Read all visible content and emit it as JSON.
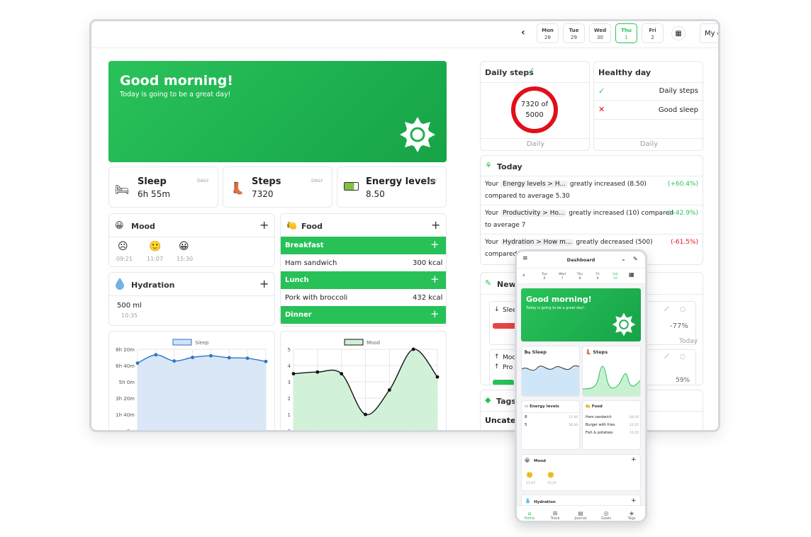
{
  "topbar": {
    "days": [
      {
        "dow": "Mon",
        "num": "28"
      },
      {
        "dow": "Tue",
        "num": "29"
      },
      {
        "dow": "Wed",
        "num": "30"
      },
      {
        "dow": "Thu",
        "num": "1"
      },
      {
        "dow": "Fri",
        "num": "2"
      }
    ],
    "dashboard_select": "My d"
  },
  "hero": {
    "title": "Good morning!",
    "subtitle": "Today is going to be a great day!"
  },
  "stats": {
    "sleep": {
      "label": "Sleep",
      "value": "6h 55m",
      "tag": "DAILY"
    },
    "steps": {
      "label": "Steps",
      "value": "7320",
      "tag": "DAILY"
    },
    "energy": {
      "label": "Energy levels",
      "value": "8.50",
      "tag": "DAILY"
    }
  },
  "mood": {
    "title": "Mood",
    "entries": [
      {
        "emoji": "☹",
        "time": "09:21"
      },
      {
        "emoji": "🙂",
        "time": "11:07"
      },
      {
        "emoji": "😀",
        "time": "15:30"
      }
    ]
  },
  "food": {
    "title": "Food",
    "meals": [
      {
        "name": "Breakfast",
        "items": [
          {
            "name": "Ham sandwich",
            "kcal": "300 kcal"
          }
        ]
      },
      {
        "name": "Lunch",
        "items": [
          {
            "name": "Pork with broccoli",
            "kcal": "432 kcal"
          }
        ]
      },
      {
        "name": "Dinner",
        "items": []
      }
    ]
  },
  "hydration": {
    "title": "Hydration",
    "value": "500 ml",
    "time": "10:35"
  },
  "sleep_chart": {
    "legend": "Sleep",
    "yticks": [
      "8h 20m",
      "6h 40m",
      "5h 0m",
      "3h 20m",
      "1h 40m",
      "0m"
    ]
  },
  "mood_chart": {
    "legend": "Mood",
    "yticks": [
      "5",
      "4",
      "3",
      "2",
      "1",
      "0"
    ]
  },
  "chart_data": [
    {
      "type": "area",
      "legend": "Sleep",
      "ylim": [
        0,
        500
      ],
      "unit": "minutes",
      "values": [
        415,
        466,
        428,
        450,
        460,
        448,
        445,
        425
      ]
    },
    {
      "type": "area",
      "legend": "Mood",
      "ylim": [
        0,
        5
      ],
      "values": [
        3.5,
        3.6,
        3.5,
        1.0,
        2.5,
        5.0,
        3.3
      ]
    }
  ],
  "daily_steps": {
    "title": "Daily steps",
    "ring_value": "7320 of",
    "ring_goal": "5000",
    "footer": "Daily",
    "progress": 1.0
  },
  "healthy_day": {
    "title": "Healthy day",
    "items": [
      {
        "label": "Daily steps",
        "ok": true
      },
      {
        "label": "Good sleep",
        "ok": false
      }
    ],
    "footer": "Daily"
  },
  "today": {
    "title": "Today",
    "insights": [
      {
        "pre": "Your",
        "chip": "Energy levels > H...",
        "post": "greatly increased (8.50)",
        "line2": "compared to average 5.30",
        "delta": "(+60.4%)",
        "pos": true
      },
      {
        "pre": "Your",
        "chip": "Productivity > Ho...",
        "post": "greatly increased (10) compared",
        "line2": "to average 7",
        "delta": "(+42.9%)",
        "pos": true
      },
      {
        "pre": "Your",
        "chip": "Hydration > How m...",
        "post": "greatly decreased (500)",
        "line2": "compared",
        "delta": "(-61.5%)",
        "pos": false
      }
    ]
  },
  "new_card": {
    "title": "New c",
    "row1_label": "Slee",
    "row1_delta": "-77%",
    "row1_foot": "Today",
    "row2_label": "Moo",
    "row3_label": "Pro",
    "row3_delta": "59%"
  },
  "tags": {
    "title": "Tags",
    "item": "Uncateg"
  },
  "phone": {
    "title": "Dashboard",
    "days": [
      {
        "dow": "Tue",
        "num": "6"
      },
      {
        "dow": "Wed",
        "num": "7"
      },
      {
        "dow": "Thu",
        "num": "8"
      },
      {
        "dow": "Fri",
        "num": "9"
      },
      {
        "dow": "Sat",
        "num": "10"
      }
    ],
    "hero_title": "Good morning!",
    "hero_sub": "Today is going to be a great day!",
    "sleep": "Sleep",
    "steps": "Steps",
    "energy": {
      "title": "Energy levels",
      "rows": [
        {
          "v": "8",
          "t": "11:49"
        },
        {
          "v": "5",
          "t": "18:30"
        }
      ]
    },
    "food": {
      "title": "Food",
      "rows": [
        {
          "v": "Ham sandwich",
          "t": "08:20"
        },
        {
          "v": "Burger with fries",
          "t": "12:25"
        },
        {
          "v": "Fish & potatoes",
          "t": "15:25"
        }
      ]
    },
    "mood": {
      "title": "Mood",
      "times": [
        "11:47",
        "15:25"
      ]
    },
    "hydration": "Hydration",
    "nav": [
      "Home",
      "Track",
      "Journal",
      "Goals",
      "Tags"
    ]
  },
  "colors": {
    "accent": "#27c158",
    "ring": "#e0101a",
    "sleep_line": "#2f73c8",
    "sleep_fill": "#d3e3f6",
    "mood_fill": "#c9f0d1"
  }
}
